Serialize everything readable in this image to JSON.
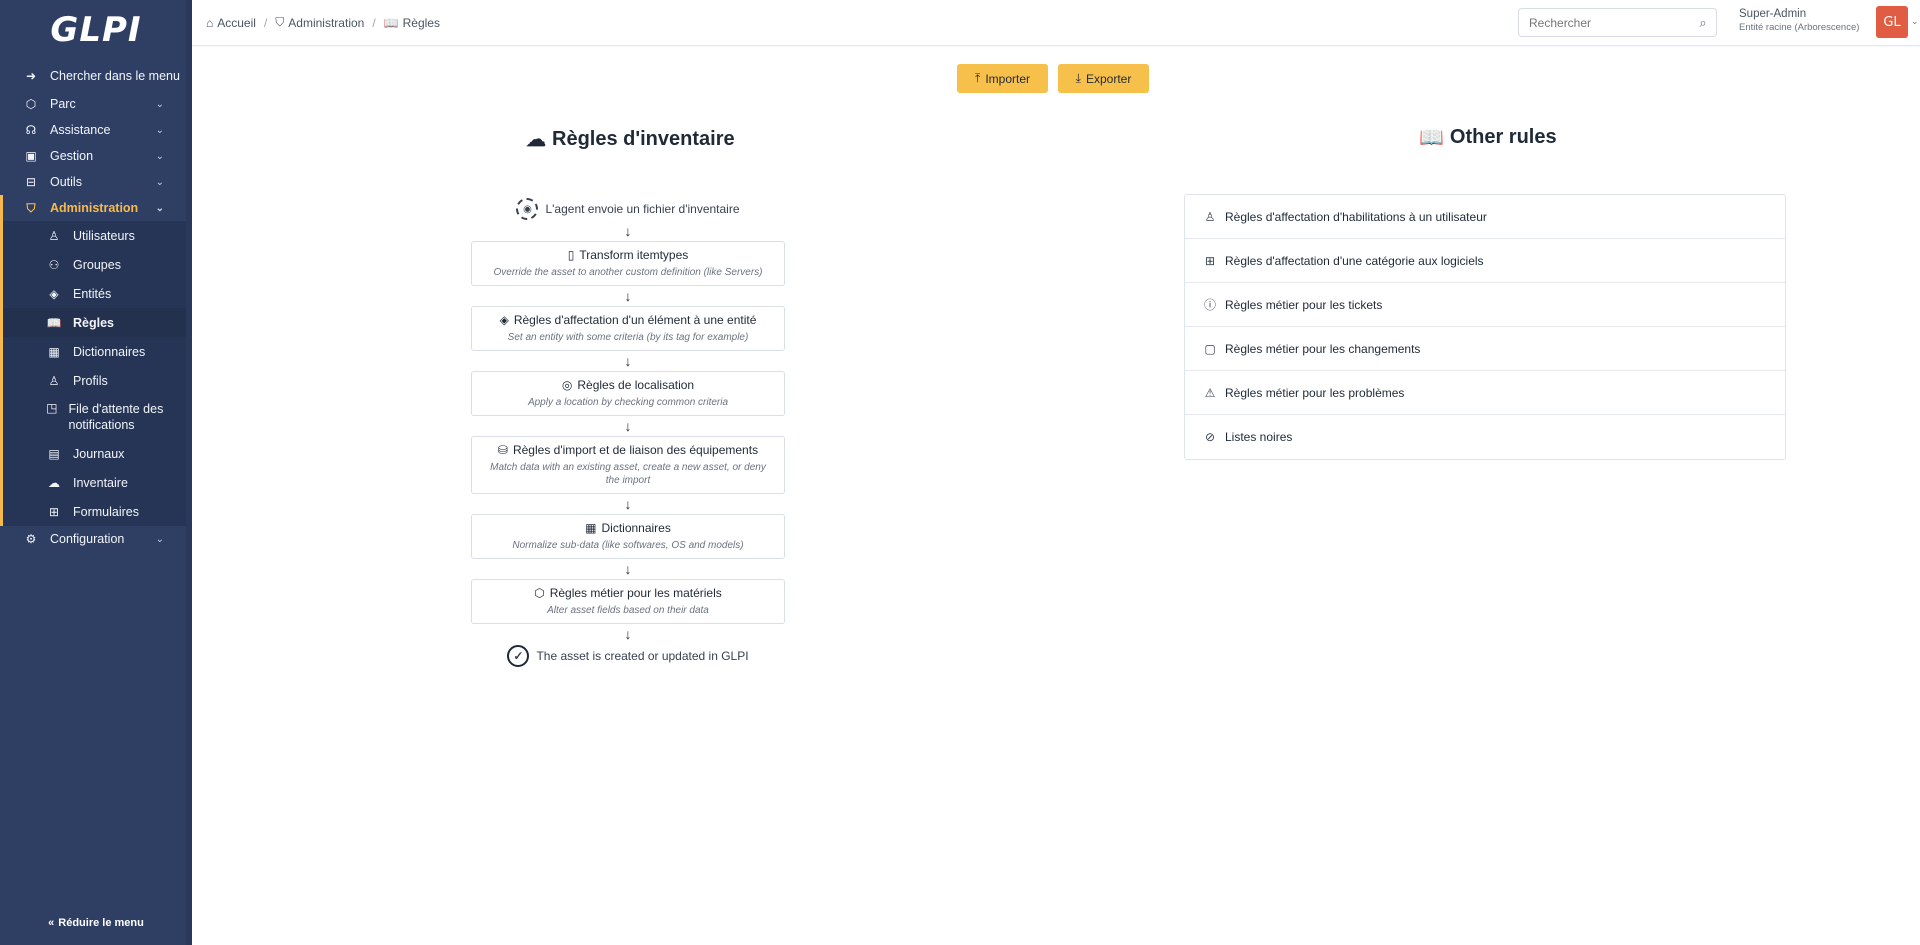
{
  "sidebar": {
    "logo": "GLPI",
    "search_menu": "Chercher dans le menu",
    "items": [
      {
        "label": "Parc"
      },
      {
        "label": "Assistance"
      },
      {
        "label": "Gestion"
      },
      {
        "label": "Outils"
      },
      {
        "label": "Administration"
      },
      {
        "label": "Configuration"
      }
    ],
    "admin_sub": [
      {
        "label": "Utilisateurs"
      },
      {
        "label": "Groupes"
      },
      {
        "label": "Entités"
      },
      {
        "label": "Règles"
      },
      {
        "label": "Dictionnaires"
      },
      {
        "label": "Profils"
      },
      {
        "label": "File d'attente des notifications"
      },
      {
        "label": "Journaux"
      },
      {
        "label": "Inventaire"
      },
      {
        "label": "Formulaires"
      }
    ],
    "reduce": "Réduire le menu"
  },
  "header": {
    "breadcrumb": [
      "Accueil",
      "Administration",
      "Règles"
    ],
    "search_placeholder": "Rechercher",
    "user_name": "Super-Admin",
    "user_entity": "Entité racine (Arborescence)",
    "avatar": "GL"
  },
  "toolbar": {
    "import": "Importer",
    "export": "Exporter"
  },
  "inventory": {
    "title": "Règles d'inventaire",
    "start": "L'agent envoie un fichier d'inventaire",
    "steps": [
      {
        "title": "Transform itemtypes",
        "desc": "Override the asset to another custom definition (like Servers)"
      },
      {
        "title": "Règles d'affectation d'un élément à une entité",
        "desc": "Set an entity with some criteria (by its tag for example)"
      },
      {
        "title": "Règles de localisation",
        "desc": "Apply a location by checking common criteria"
      },
      {
        "title": "Règles d'import et de liaison des équipements",
        "desc": "Match data with an existing asset, create a new asset, or deny the import"
      },
      {
        "title": "Dictionnaires",
        "desc": "Normalize sub-data (like softwares, OS and models)"
      },
      {
        "title": "Règles métier pour les matériels",
        "desc": "Alter asset fields based on their data"
      }
    ],
    "end": "The asset is created or updated in GLPI"
  },
  "other": {
    "title": "Other rules",
    "items": [
      {
        "label": "Règles d'affectation d'habilitations à un utilisateur"
      },
      {
        "label": "Règles d'affectation d'une catégorie aux logiciels"
      },
      {
        "label": "Règles métier pour les tickets"
      },
      {
        "label": "Règles métier pour les changements"
      },
      {
        "label": "Règles métier pour les problèmes"
      },
      {
        "label": "Listes noires"
      }
    ]
  },
  "colors": {
    "sidebar_bg": "#2f3f64",
    "accent": "#f7b94c",
    "button": "#f7c04b",
    "avatar": "#e05d44"
  }
}
